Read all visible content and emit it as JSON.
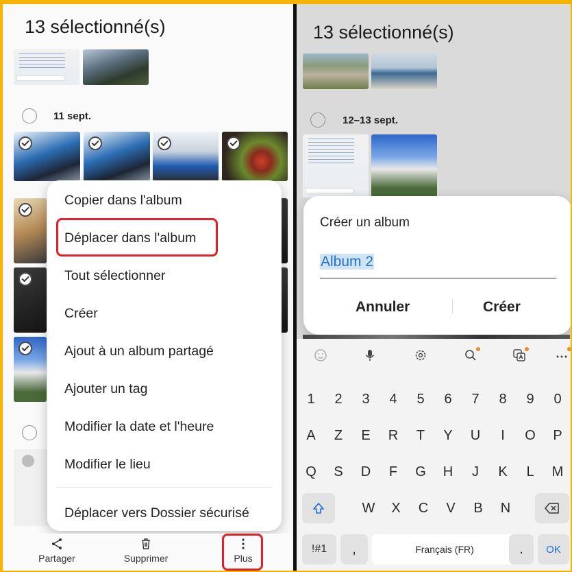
{
  "left": {
    "title": "13 sélectionné(s)",
    "date_group": "11 sept.",
    "menu": {
      "items": [
        "Copier dans l'album",
        "Déplacer dans l'album",
        "Tout sélectionner",
        "Créer",
        "Ajout à un album partagé",
        "Ajouter un tag",
        "Modifier la date et l'heure",
        "Modifier le lieu",
        "Déplacer vers Dossier sécurisé"
      ],
      "highlighted_item": "Déplacer dans l'album"
    },
    "bottom_bar": {
      "share": "Partager",
      "delete": "Supprimer",
      "more": "Plus"
    }
  },
  "right": {
    "title": "13 sélectionné(s)",
    "date_group": "12–13 sept.",
    "dialog": {
      "title": "Créer un album",
      "input_value": "Album 2",
      "cancel": "Annuler",
      "create": "Créer"
    },
    "keyboard": {
      "toolbar_icons": [
        "emoji-icon",
        "microphone-icon",
        "settings-icon",
        "search-icon",
        "translate-icon",
        "more-icon"
      ],
      "row_numbers": [
        "1",
        "2",
        "3",
        "4",
        "5",
        "6",
        "7",
        "8",
        "9",
        "0"
      ],
      "row_1": [
        "A",
        "Z",
        "E",
        "R",
        "T",
        "Y",
        "U",
        "I",
        "O",
        "P"
      ],
      "row_2": [
        "Q",
        "S",
        "D",
        "F",
        "G",
        "H",
        "J",
        "K",
        "L",
        "M"
      ],
      "row_3": [
        "W",
        "X",
        "C",
        "V",
        "B",
        "N"
      ],
      "symbols_key": "!#1",
      "comma_key": ",",
      "space_label": "Français (FR)",
      "period_key": ".",
      "ok_key": "OK"
    }
  },
  "colors": {
    "accent_frame": "#f5b400",
    "highlight_red": "#e0202a",
    "keyboard_blue": "#1b6fd4"
  }
}
